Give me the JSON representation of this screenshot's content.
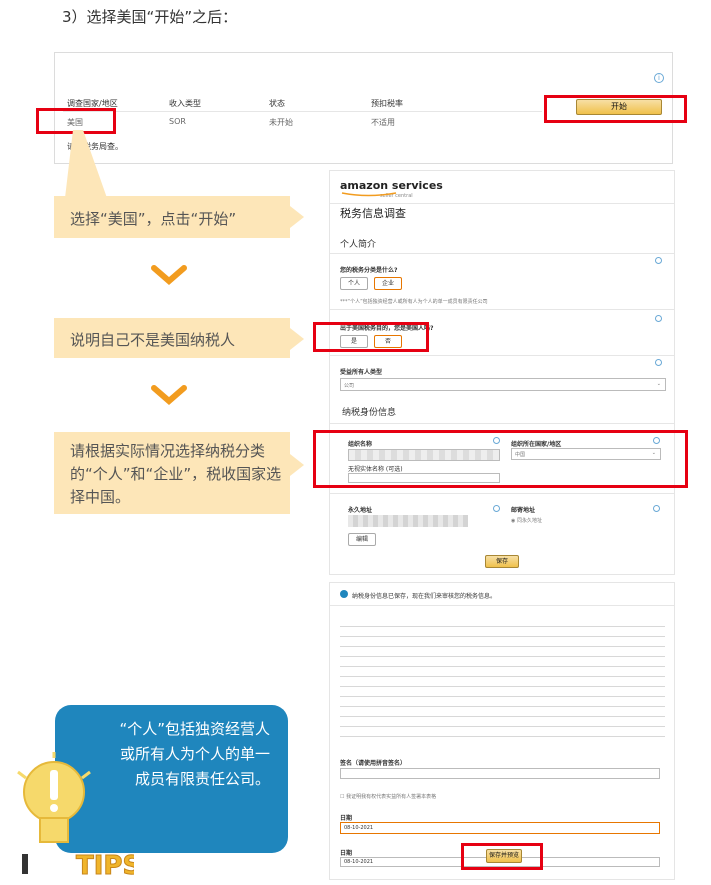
{
  "step_title": "3）选择美国“开始”之后：",
  "top_panel": {
    "headers": [
      "调查国家/地区",
      "收入类型",
      "状态",
      "预扣税率"
    ],
    "values": [
      "美国",
      "SOR",
      "未开始",
      "不适用"
    ],
    "start_label": "开始",
    "note": "请与税务局查。"
  },
  "callouts": {
    "c1": "选择“美国”，点击“开始”",
    "c2": "说明自己不是美国纳税人",
    "c3": "请根据实际情况选择纳税分类的“个人”和“企业”，税收国家选择中国。"
  },
  "form1": {
    "logo": "amazon services",
    "logo_sub": "seller central",
    "title": "税务信息调查",
    "section1": "个人简介",
    "q1": "您的税务分类是什么?",
    "opt_individual": "个人",
    "opt_business": "企业",
    "q1_hint": "***“个人”包括独资经营人或所有人为个人的单一成员有限责任公司",
    "q2": "出于美国税务目的，您是美国人吗?",
    "opt_yes": "是",
    "opt_no": "否",
    "owner_type_label": "受益所有人类型",
    "owner_type_value": "公司",
    "section2": "纳税身份信息",
    "org_name_label": "组织名称",
    "country_label": "组织所在国家/地区",
    "country_value": "中国",
    "dba_label": "无视实体名称 (可选)",
    "addr_label": "永久地址",
    "mail_label": "邮寄地址",
    "mail_option": "同永久地址",
    "edit_label": "编辑",
    "save_label": "保存"
  },
  "form2": {
    "header": "纳税身份信息已保存，现在我们来审核您的税务信息。",
    "name_label": "签名（请使用拼音签名）",
    "checkbox_label": "我证明我有权代表实益所有人签署本表格",
    "date_label": "日期",
    "date_value": "08-10-2021",
    "date2_label": "日期",
    "date2_value": "08-10-2021",
    "submit_label": "保存并预览"
  },
  "tips": {
    "text": "“个人”包括独资经营人或所有人为个人的单一成员有限责任公司。",
    "badge": "TIPS"
  }
}
